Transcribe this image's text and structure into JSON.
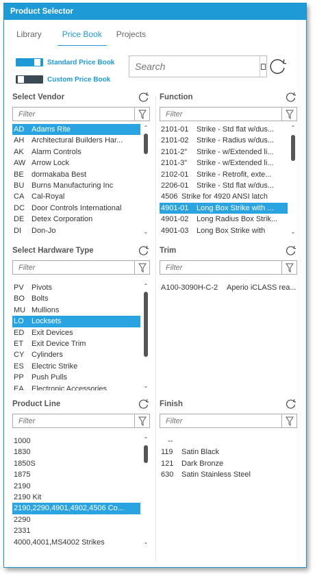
{
  "window": {
    "title": "Product Selector"
  },
  "tabs": [
    {
      "label": "Library"
    },
    {
      "label": "Price Book"
    },
    {
      "label": "Projects"
    }
  ],
  "toggles": {
    "standard": "Standard Price Book",
    "custom": "Custom Price Book"
  },
  "search": {
    "placeholder": "Search"
  },
  "filter_placeholder": "Filter",
  "vendor": {
    "title": "Select Vendor",
    "rows": [
      [
        "AD",
        "Adams Rite"
      ],
      [
        "AH",
        "Architectural Builders Har..."
      ],
      [
        "AK",
        "Alarm Controls"
      ],
      [
        "AW",
        "Arrow Lock"
      ],
      [
        "BE",
        "dormakaba Best"
      ],
      [
        "BU",
        "Burns Manufacturing Inc"
      ],
      [
        "CA",
        "Cal-Royal"
      ],
      [
        "DC",
        "Door Controls International"
      ],
      [
        "DE",
        "Detex Corporation"
      ],
      [
        "DI",
        "Don-Jo"
      ]
    ]
  },
  "function": {
    "title": "Function",
    "rows": [
      [
        "2101-01",
        "Strike - Std flat w/dus..."
      ],
      [
        "2101-02",
        "Strike - Radius w/dus..."
      ],
      [
        "2101-2\"",
        "Strike - w/Extended li..."
      ],
      [
        "2101-3\"",
        "Strike - w/Extended li..."
      ],
      [
        "2102-01",
        "Strike - Retrofit, exte..."
      ],
      [
        "2206-01",
        "Strike - Std flat w/dus..."
      ],
      [
        "4506",
        "Strike for 4920 ANSI latch"
      ],
      [
        "4901-01",
        "Long Box Strike with ..."
      ],
      [
        "4901-02",
        "Long Radius Box Strik..."
      ],
      [
        "4901-03",
        "Long Box Strike with"
      ]
    ]
  },
  "hardware": {
    "title": "Select Hardware Type",
    "rows": [
      [
        "PV",
        "Pivots"
      ],
      [
        "BO",
        "Bolts"
      ],
      [
        "MU",
        "Mullions"
      ],
      [
        "LO",
        "Locksets"
      ],
      [
        "ED",
        "Exit Devices"
      ],
      [
        "ET",
        "Exit Device Trim"
      ],
      [
        "CY",
        "Cylinders"
      ],
      [
        "ES",
        "Electric Strike"
      ],
      [
        "PP",
        "Push Pulls"
      ],
      [
        "EA",
        "Electronic Accessories"
      ]
    ]
  },
  "trim": {
    "title": "Trim",
    "rows": [
      [
        "A100-3090H-C-2",
        "Aperio iCLASS rea..."
      ]
    ]
  },
  "product_line": {
    "title": "Product Line",
    "rows": [
      "1000",
      "1830",
      "1850S",
      "1875",
      "2190",
      "2190 Kit",
      "2190,2290,4901,4902,4506 Co...",
      "2290",
      "2331",
      "4000,4001,MS4002 Strikes"
    ]
  },
  "finish": {
    "title": "Finish",
    "rows": [
      [
        "",
        "--"
      ],
      [
        "119",
        "Satin Black"
      ],
      [
        "121",
        "Dark Bronze"
      ],
      [
        "630",
        "Satin Stainless Steel"
      ]
    ]
  }
}
